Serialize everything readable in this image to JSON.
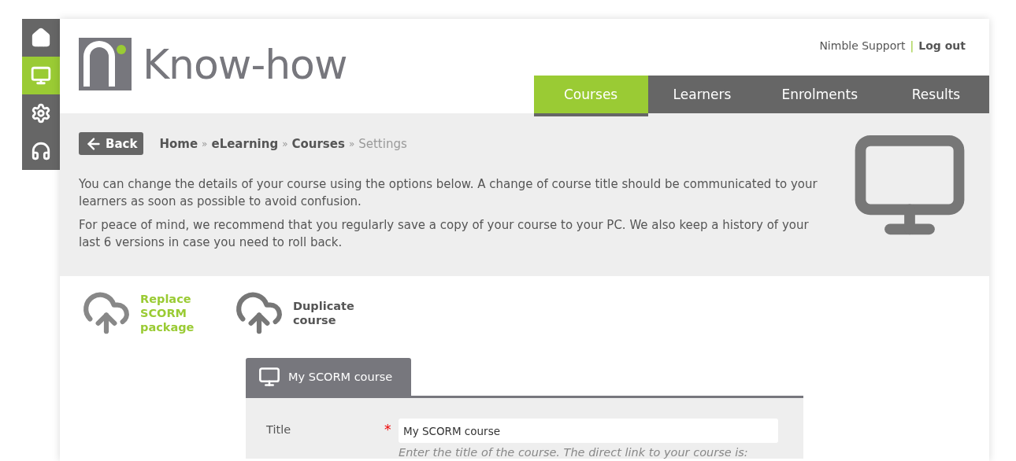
{
  "sidebar": {
    "items": [
      {
        "selected": false
      },
      {
        "selected": true
      },
      {
        "selected": false
      },
      {
        "selected": false
      }
    ]
  },
  "header": {
    "brand": "Know-how",
    "user": "Nimble Support",
    "separator": "|",
    "logout": "Log out"
  },
  "nav_tabs": [
    {
      "label": "Courses",
      "selected": true
    },
    {
      "label": "Learners",
      "selected": false
    },
    {
      "label": "Enrolments",
      "selected": false
    },
    {
      "label": "Results",
      "selected": false
    }
  ],
  "back_button": "Back",
  "breadcrumb": {
    "separator": "»",
    "items": [
      {
        "label": "Home",
        "current": false
      },
      {
        "label": "eLearning",
        "current": false
      },
      {
        "label": "Courses",
        "current": false
      },
      {
        "label": "Settings",
        "current": true
      }
    ]
  },
  "intro": [
    "You can change the details of your course using the options below. A change of course title should be communicated to your learners as soon as possible to avoid confusion.",
    "For peace of mind, we recommend that you regularly save a copy of your course to your PC. We also keep a history of your last 6 versions in case you need to roll back."
  ],
  "actions": [
    {
      "label": "Replace SCORM package",
      "highlighted": true
    },
    {
      "label": "Duplicate course",
      "highlighted": false
    }
  ],
  "course_tab": {
    "label": "My SCORM course"
  },
  "form": {
    "fields": [
      {
        "label": "Title",
        "required_mark": "*",
        "value": "My SCORM course",
        "hint": "Enter the title of the course. The direct link to your course is:"
      }
    ]
  }
}
